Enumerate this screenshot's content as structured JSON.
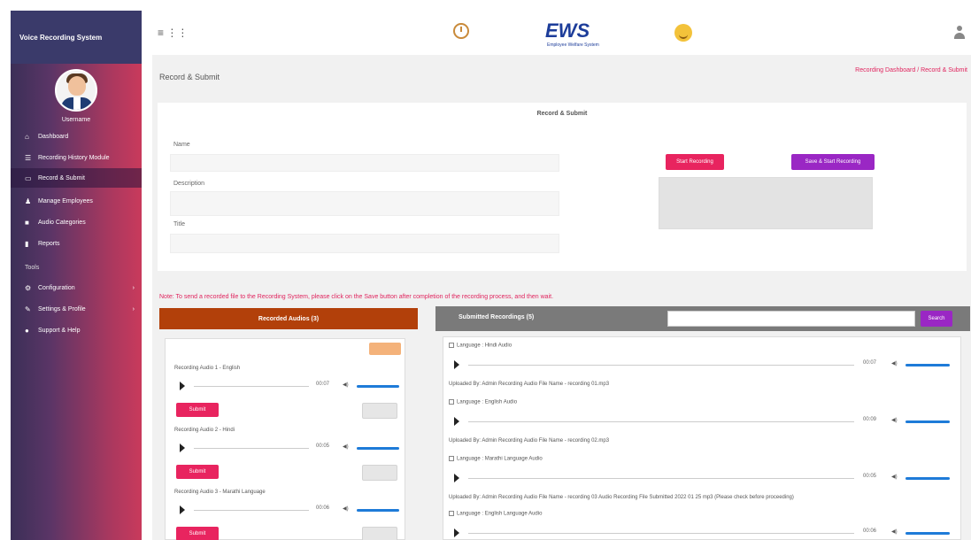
{
  "sidebar": {
    "title": "Voice Recording System",
    "user_name": "Username",
    "items": [
      {
        "icon": "home-icon",
        "label": "Dashboard",
        "active": false,
        "caret": false
      },
      {
        "icon": "list-icon",
        "label": "Recording History Module",
        "active": false,
        "caret": false
      },
      {
        "icon": "chat-icon",
        "label": "Record & Submit",
        "active": true,
        "caret": false
      },
      {
        "icon": "user-icon",
        "label": "Manage Employees",
        "active": false,
        "caret": false
      },
      {
        "icon": "folder-icon",
        "label": "Audio Categories",
        "active": false,
        "caret": false
      },
      {
        "icon": "file-icon",
        "label": "Reports",
        "active": false,
        "caret": false
      }
    ],
    "section_label": "Tools",
    "items2": [
      {
        "icon": "gear-icon",
        "label": "Configuration",
        "caret": true
      },
      {
        "icon": "wrench-icon",
        "label": "Settings & Profile",
        "caret": true
      },
      {
        "icon": "info-icon",
        "label": "Support & Help",
        "caret": false
      }
    ]
  },
  "topbar": {
    "menu_icons": "≡  ⋮⋮",
    "logo_text": "EWS",
    "logo_sub": "Employee Welfare System"
  },
  "breadcrumb": "Record & Submit",
  "breadcrumb_right": "Recording Dashboard / Record & Submit",
  "form": {
    "title": "Record & Submit",
    "fields": [
      {
        "label": "Name"
      },
      {
        "label": "Description"
      },
      {
        "label": "Title"
      }
    ],
    "record_button": "Start Recording",
    "record_stop_button": "Save & Start Recording"
  },
  "note": "Note: To send a recorded file to the Recording System, please click on the Save button after completion of the recording process, and then wait.",
  "left_panel": {
    "title": "Recorded Audios (3)",
    "items": [
      {
        "title": "Recording Audio 1 - English",
        "time": "00:07",
        "button": "Submit"
      },
      {
        "title": "Recording Audio 2 - Hindi",
        "time": "00:05",
        "button": "Submit"
      },
      {
        "title": "Recording Audio 3 - Marathi Language",
        "time": "00:06",
        "button": "Submit"
      }
    ]
  },
  "right_panel": {
    "title": "Submitted Recordings (5)",
    "search_button": "Search",
    "items": [
      {
        "label": "Language : Hindi Audio",
        "time": "00:07",
        "file": "Uploaded By: Admin Recording Audio File Name - recording 01.mp3"
      },
      {
        "label": "Language : English Audio",
        "time": "00:09",
        "file": "Uploaded By: Admin Recording Audio File Name - recording 02.mp3"
      },
      {
        "label": "Language : Marathi Language Audio",
        "time": "00:05",
        "file": "Uploaded By: Admin Recording Audio File Name - recording 03 Audio Recording File Submitted 2022 01 25 mp3 (Please check before proceeding)"
      },
      {
        "label": "Language : English Language Audio",
        "time": "00:06",
        "file": ""
      }
    ]
  }
}
